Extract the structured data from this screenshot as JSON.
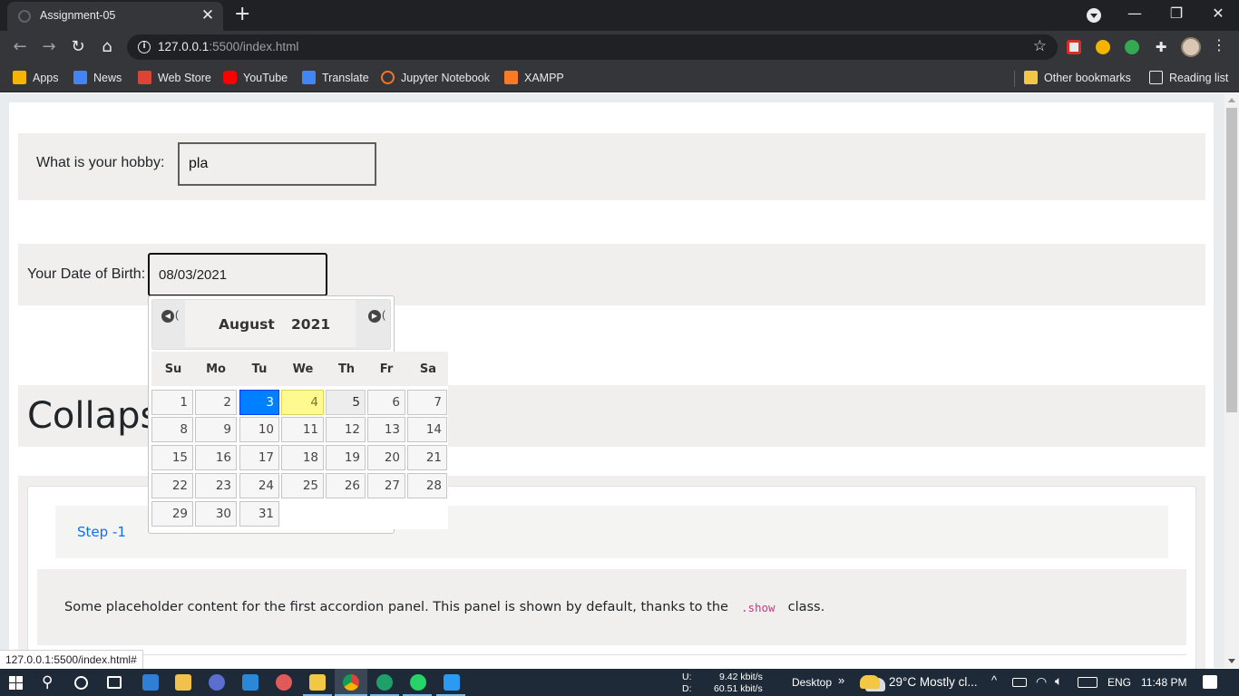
{
  "browser": {
    "tab_title": "Assignment-05",
    "tab_close": "✕",
    "new_tab": "+",
    "url_host": "127.0.0.1",
    "url_rest": ":5500/index.html",
    "window_controls": {
      "minimize": "—",
      "restore": "❐",
      "close": "✕"
    },
    "bookmarks": [
      {
        "label": "Apps",
        "icon": "apps-grid-icon",
        "color": "#f4b400"
      },
      {
        "label": "News",
        "icon": "google-news-icon",
        "color": "#4285f4"
      },
      {
        "label": "Web Store",
        "icon": "web-store-icon",
        "color": "#db4437"
      },
      {
        "label": "YouTube",
        "icon": "youtube-icon",
        "color": "#ff0000"
      },
      {
        "label": "Translate",
        "icon": "translate-icon",
        "color": "#4285f4"
      },
      {
        "label": "Jupyter Notebook",
        "icon": "jupyter-icon",
        "color": "#f37626"
      },
      {
        "label": "XAMPP",
        "icon": "xampp-icon",
        "color": "#fb7a24"
      }
    ],
    "other_bookmarks": "Other bookmarks",
    "reading_list": "Reading list",
    "status_url": "127.0.0.1:5500/index.html#"
  },
  "page": {
    "hobby_label": "What is your hobby:",
    "hobby_value": "pla",
    "dob_label": "Your Date of Birth:",
    "dob_value": "08/03/2021",
    "heading": "Collaps",
    "accordion": {
      "step_label": "Step -1",
      "body_text_before": "Some placeholder content for the first accordion panel. This panel is shown by default, thanks to the",
      "body_code": ".show",
      "body_text_after": "class."
    }
  },
  "datepicker": {
    "month": "August",
    "year": "2021",
    "weekdays": [
      "Su",
      "Mo",
      "Tu",
      "We",
      "Th",
      "Fr",
      "Sa"
    ],
    "days": [
      "1",
      "2",
      "3",
      "4",
      "5",
      "6",
      "7",
      "8",
      "9",
      "10",
      "11",
      "12",
      "13",
      "14",
      "15",
      "16",
      "17",
      "18",
      "19",
      "20",
      "21",
      "22",
      "23",
      "24",
      "25",
      "26",
      "27",
      "28",
      "29",
      "30",
      "31"
    ],
    "selected_day": "3",
    "today_day": "4",
    "hover_day": "5",
    "colors": {
      "selected": "#007fff",
      "today": "#fffa90",
      "hover": "#ededed"
    }
  },
  "taskbar": {
    "net_up_label": "U:",
    "net_up": "9.42 kbit/s",
    "net_down_label": "D:",
    "net_down": "60.51 kbit/s",
    "desktop": "Desktop",
    "chevron": "»",
    "weather": "29°C  Mostly cl...",
    "lang": "ENG",
    "time": "11:48 PM",
    "apps": [
      {
        "name": "start-icon",
        "color": "#ffffff"
      },
      {
        "name": "search-icon",
        "color": "#ffffff"
      },
      {
        "name": "cortana-icon",
        "color": "#ffffff"
      },
      {
        "name": "task-view-icon",
        "color": "#ffffff"
      },
      {
        "name": "app-tile-blue-icon",
        "color": "#2f7fd6"
      },
      {
        "name": "store-icon",
        "color": "#f0c24b"
      },
      {
        "name": "app-circle-icon",
        "color": "#5b6ed0"
      },
      {
        "name": "mail-icon",
        "color": "#2b88d8"
      },
      {
        "name": "snip-icon",
        "color": "#e05a5a"
      },
      {
        "name": "file-explorer-icon",
        "color": "#f2c744"
      },
      {
        "name": "chrome-icon",
        "color": "#db4437"
      },
      {
        "name": "edge-icon",
        "color": "#1fa06a"
      },
      {
        "name": "whatsapp-icon",
        "color": "#25d366"
      },
      {
        "name": "vscode-icon",
        "color": "#2b9af3"
      }
    ]
  }
}
